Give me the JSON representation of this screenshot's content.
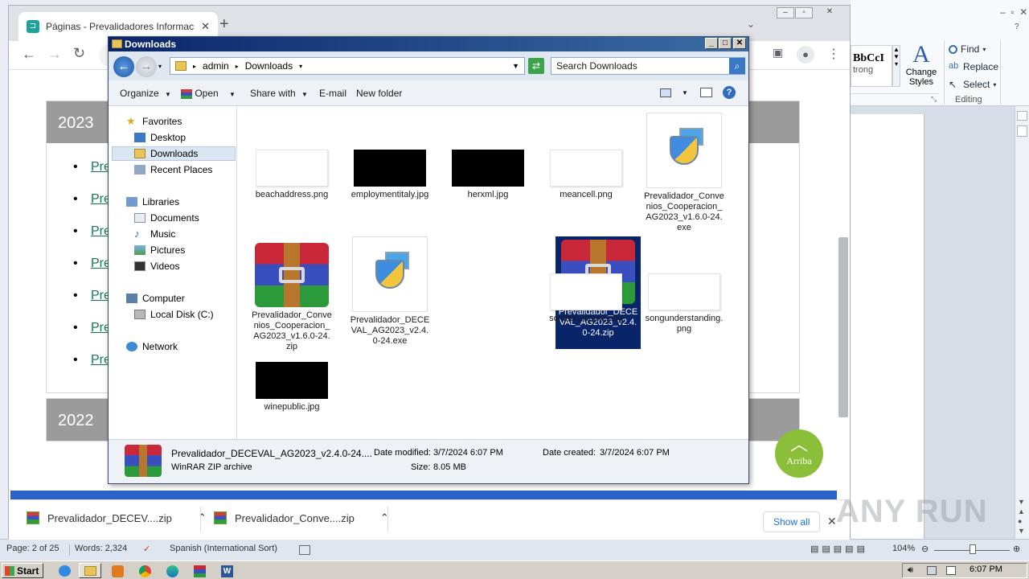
{
  "word": {
    "ribbon": {
      "style_preview": "BbCcI",
      "style_name": "trong",
      "change_styles": [
        "Change",
        "Styles"
      ],
      "find": "Find",
      "replace": "Replace",
      "select": "Select",
      "group_label": "Editing"
    },
    "status": {
      "page": "Page: 2 of 25",
      "words": "Words: 2,324",
      "language": "Spanish (International Sort)",
      "zoom": "104%"
    }
  },
  "chrome": {
    "tab_title": "Páginas - Prevalidadores Informacion",
    "new_tab": "+",
    "sections": [
      {
        "year": "2023",
        "link_prefix": "Pre",
        "link_count": 7
      },
      {
        "year": "2022"
      }
    ],
    "links": [
      "Pre",
      "Pre",
      "Pre",
      "Pre",
      "Pre",
      "Pre",
      "Pre"
    ],
    "arriba_label": "Arriba",
    "downloads": [
      {
        "name": "Prevalidador_DECEV....zip"
      },
      {
        "name": "Prevalidador_Conve....zip"
      }
    ],
    "show_all": "Show all"
  },
  "explorer": {
    "title": "Downloads",
    "breadcrumb": [
      "admin",
      "Downloads"
    ],
    "search_placeholder": "Search Downloads",
    "commands": {
      "organize": "Organize",
      "open": "Open",
      "share_with": "Share with",
      "email": "E-mail",
      "new_folder": "New folder"
    },
    "nav": {
      "favorites": "Favorites",
      "desktop": "Desktop",
      "downloads": "Downloads",
      "recent_places": "Recent Places",
      "libraries": "Libraries",
      "documents": "Documents",
      "music": "Music",
      "pictures": "Pictures",
      "videos": "Videos",
      "computer": "Computer",
      "local_disk": "Local Disk (C:)",
      "network": "Network"
    },
    "files": [
      {
        "name": "beachaddress.png",
        "kind": "png"
      },
      {
        "name": "employmentitaly.jpg",
        "kind": "dark"
      },
      {
        "name": "herxml.jpg",
        "kind": "dark"
      },
      {
        "name": "meancell.png",
        "kind": "png"
      },
      {
        "name": "Prevalidador_Convenios_Cooperacion_AG2023_v1.6.0-24.exe",
        "kind": "exe"
      },
      {
        "name": "Prevalidador_Convenios_Cooperacion_AG2023_v1.6.0-24.zip",
        "kind": "rar"
      },
      {
        "name": "Prevalidador_DECEVAL_AG2023_v2.4.0-24.exe",
        "kind": "exe"
      },
      {
        "name": "Prevalidador_DECEVAL_AG2023_v2.4.0-24.zip",
        "kind": "rar",
        "selected": true
      },
      {
        "name": "solutionscome.png",
        "kind": "png"
      },
      {
        "name": "songunderstanding.png",
        "kind": "png"
      },
      {
        "name": "winepublic.jpg",
        "kind": "dark"
      }
    ],
    "details": {
      "name": "Prevalidador_DECEVAL_AG2023_v2.4.0-24....",
      "type": "WinRAR ZIP archive",
      "modified_label": "Date modified:",
      "modified": "3/7/2024 6:07 PM",
      "created_label": "Date created:",
      "created": "3/7/2024 6:07 PM",
      "size_label": "Size:",
      "size": "8.05 MB"
    }
  },
  "taskbar": {
    "start": "Start",
    "clock": "6:07 PM"
  },
  "watermark": "ANY RUN"
}
